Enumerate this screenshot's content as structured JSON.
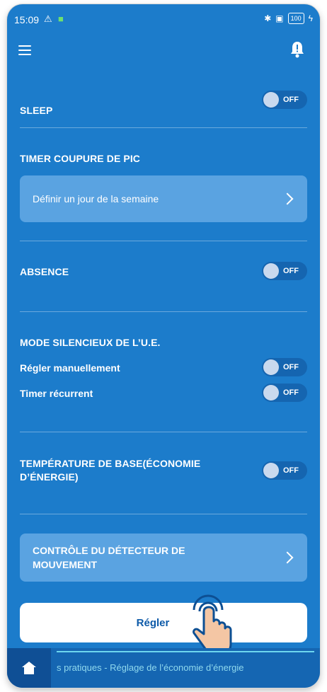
{
  "status": {
    "time": "15:09",
    "battery": "100"
  },
  "sections": {
    "sleep": {
      "title": "SLEEP",
      "toggle": "OFF"
    },
    "peak_timer": {
      "title": "TIMER COUPURE DE PIC",
      "button_label": "Définir un jour de la semaine"
    },
    "absence": {
      "title": "ABSENCE",
      "toggle": "OFF"
    },
    "silent_mode": {
      "title": "MODE SILENCIEUX DE L’U.E.",
      "manual_label": "Régler manuellement",
      "manual_toggle": "OFF",
      "recurrent_label": "Timer récurrent",
      "recurrent_toggle": "OFF"
    },
    "base_temp": {
      "title_line1": "TEMPÉRATURE DE BASE(ÉCONOMIE",
      "title_line2": "D’ÉNERGIE)",
      "toggle": "OFF"
    },
    "motion": {
      "label_line1": "CONTRÔLE DU DÉTECTEUR DE",
      "label_line2": "MOUVEMENT"
    }
  },
  "actions": {
    "set_label": "Régler"
  },
  "footer": {
    "ticker": "s pratiques - Réglage de l’économie d’énergie"
  },
  "colors": {
    "background": "#1c7ccb",
    "card": "#5aa3e1",
    "button_text": "#0d5aa8"
  }
}
